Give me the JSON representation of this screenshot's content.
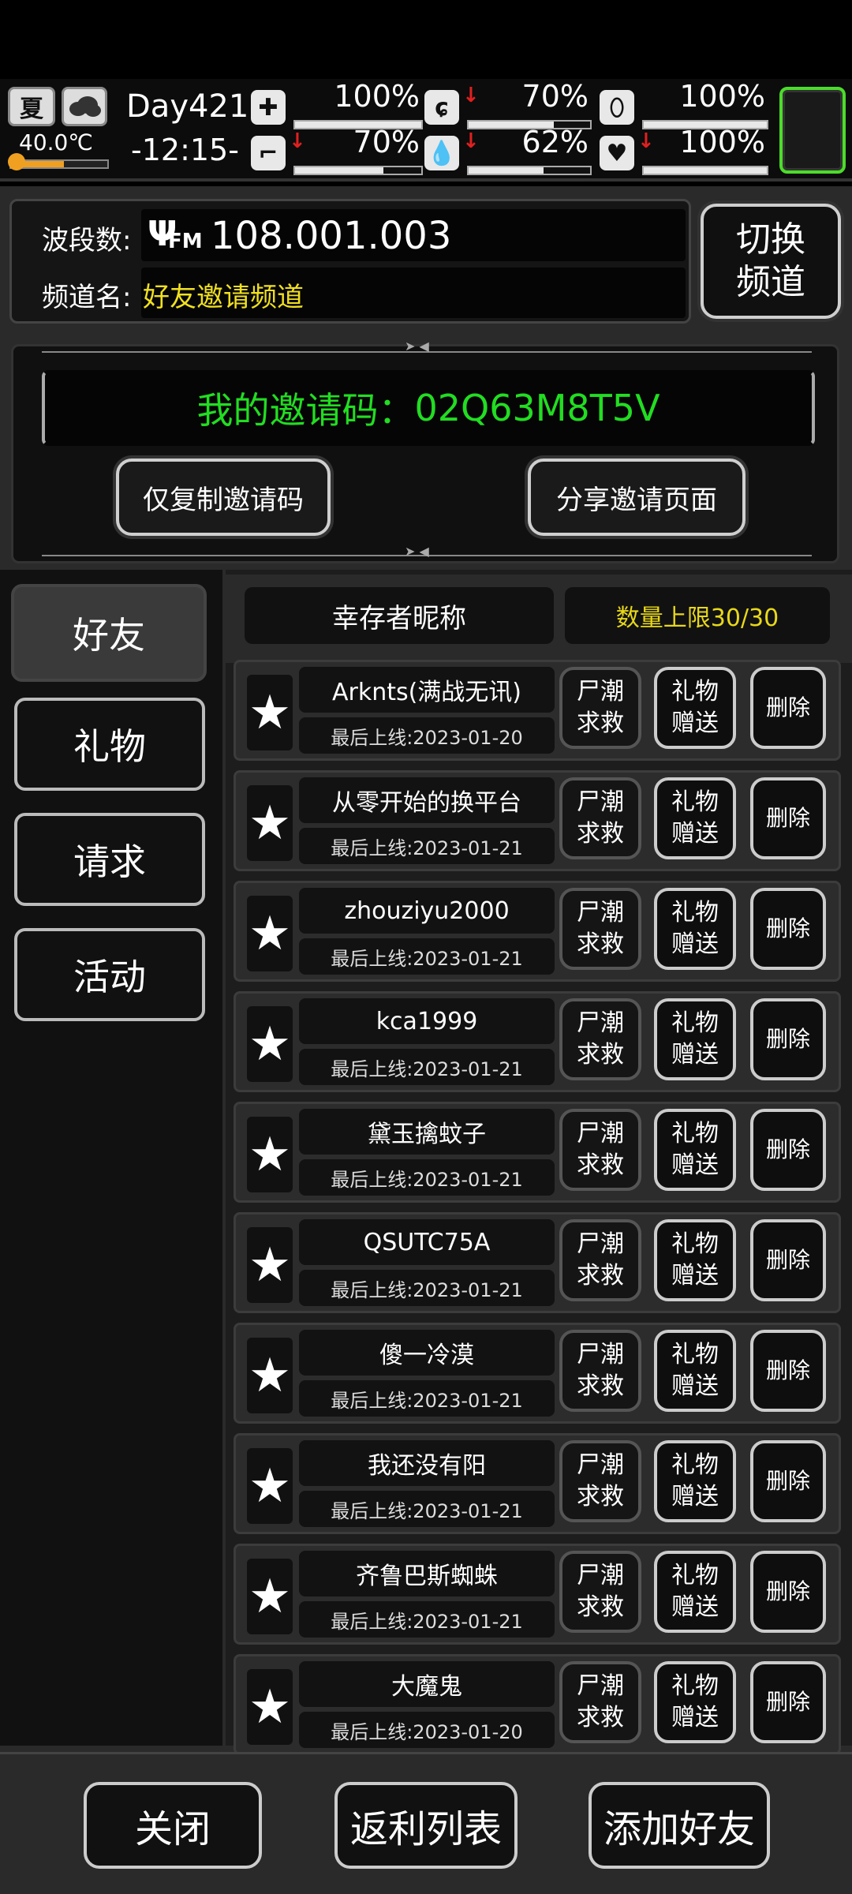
{
  "status": {
    "season": "夏",
    "temperature": "40.0℃",
    "day": "Day421",
    "time": "-12:15-",
    "stats": [
      {
        "icon": "medkit-icon",
        "value": "100%",
        "level": 1.0,
        "down": false
      },
      {
        "icon": "stomach-icon",
        "value": "70%",
        "level": 0.7,
        "down": true
      },
      {
        "icon": "shield-icon",
        "value": "100%",
        "level": 1.0,
        "down": false
      },
      {
        "icon": "boot-icon",
        "value": "70%",
        "level": 0.7,
        "down": true
      },
      {
        "icon": "water-drop-icon",
        "value": "62%",
        "level": 0.62,
        "down": true
      },
      {
        "icon": "heart-icon",
        "value": "100%",
        "level": 1.0,
        "down": true
      }
    ]
  },
  "radio": {
    "band_label": "波段数:",
    "fm": "FM",
    "frequency": "108.001.003",
    "channel_label": "频道名:",
    "channel_name": "好友邀请频道",
    "switch_line1": "切换",
    "switch_line2": "频道"
  },
  "invite": {
    "code_label": "我的邀请码：",
    "code": "02Q63M8T5V",
    "copy_button": "仅复制邀请码",
    "share_button": "分享邀请页面"
  },
  "tabs": [
    "好友",
    "礼物",
    "请求",
    "活动"
  ],
  "list_header": {
    "name_col": "幸存者昵称",
    "limit": "数量上限30/30"
  },
  "row_buttons": {
    "horde1": "尸潮",
    "horde2": "求救",
    "gift1": "礼物",
    "gift2": "赠送",
    "delete": "删除"
  },
  "friends": [
    {
      "name": "Arknts(满战无讯)",
      "last": "最后上线:2023-01-20"
    },
    {
      "name": "从零开始的换平台",
      "last": "最后上线:2023-01-21"
    },
    {
      "name": "zhouziyu2000",
      "last": "最后上线:2023-01-21"
    },
    {
      "name": "kca1999",
      "last": "最后上线:2023-01-21"
    },
    {
      "name": "黛玉擒蚊子",
      "last": "最后上线:2023-01-21"
    },
    {
      "name": "QSUTC75A",
      "last": "最后上线:2023-01-21"
    },
    {
      "name": "傻一冷漠",
      "last": "最后上线:2023-01-21"
    },
    {
      "name": "我还没有阳",
      "last": "最后上线:2023-01-21"
    },
    {
      "name": "齐鲁巴斯蜘蛛",
      "last": "最后上线:2023-01-21"
    },
    {
      "name": "大魔鬼",
      "last": "最后上线:2023-01-20"
    }
  ],
  "bottom": {
    "close": "关闭",
    "rebate": "返利列表",
    "add": "添加好友"
  },
  "colors": {
    "accent_green": "#22dd22",
    "channel_yellow": "#f0e020",
    "limit_yellow": "#e8d81a",
    "alert_red": "#e02020"
  }
}
